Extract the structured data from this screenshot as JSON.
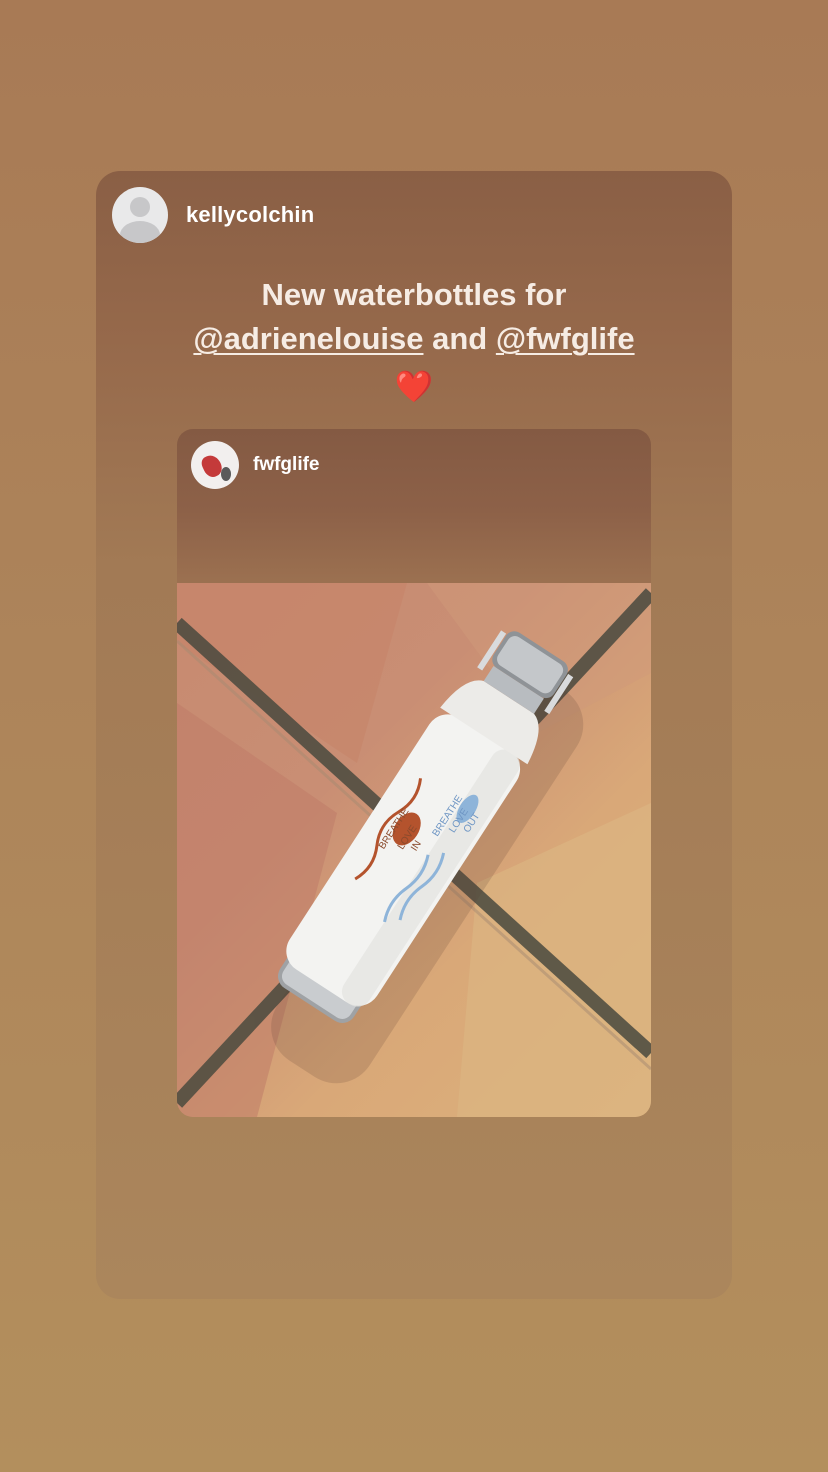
{
  "story": {
    "author": {
      "username": "kellycolchin",
      "avatar_icon": "default-avatar-icon"
    },
    "caption": {
      "line1": "New waterbottles for",
      "mention1": "@adrienelouise",
      "connector": "and",
      "mention2": "@fwfglife",
      "emoji": "❤️"
    },
    "shared_post": {
      "username": "fwfglife",
      "avatar_icon": "profile-photo-icon",
      "photo_text": {
        "line1": "BREATHE",
        "line2": "LOVE",
        "line3": "IN",
        "line4": "BREATHE",
        "line5": "LOVE",
        "line6": "OUT"
      }
    }
  },
  "colors": {
    "background": "#ad845a",
    "card": "#96694b",
    "text": "#ffffff"
  }
}
